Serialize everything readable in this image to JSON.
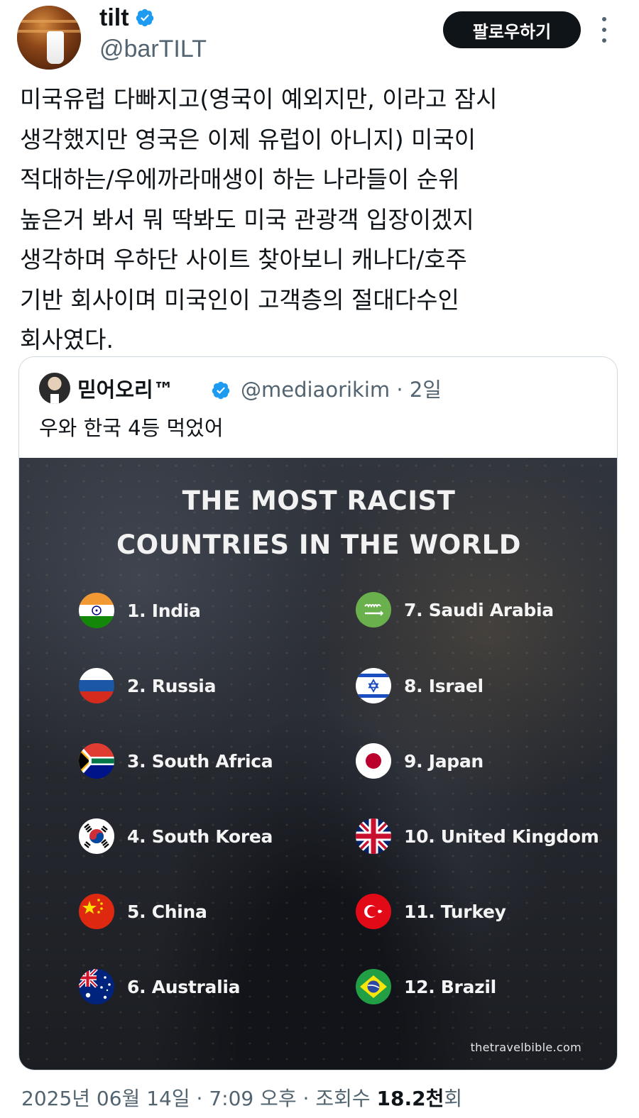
{
  "author": {
    "display_name": "tilt",
    "handle": "@barTILT",
    "verified": true
  },
  "follow_button_label": "팔로우하기",
  "tweet_text": "미국유럽 다빠지고(영국이 예외지만, 이라고 잠시\n생각했지만 영국은 이제 유럽이 아니지) 미국이\n적대하는/우에까라매생이 하는 나라들이 순위\n높은거 봐서 뭐 딱봐도 미국 관광객 입장이겠지\n생각하며 우하단 사이트 찾아보니 캐나다/호주\n기반 회사이며 미국인이 고객층의 절대다수인\n회사였다.",
  "quote": {
    "display_name": "믿어오리™",
    "handle": "@mediaorikim",
    "time_separator": "·",
    "time": "2일",
    "text": "우와 한국 4등 먹었어",
    "image": {
      "title_line1": "THE MOST RACIST",
      "title_line2": "COUNTRIES IN THE WORLD",
      "rankings": [
        {
          "label": "1. India",
          "flag": "india-flag-icon"
        },
        {
          "label": "2. Russia",
          "flag": "russia-flag-icon"
        },
        {
          "label": "3. South Africa",
          "flag": "south-africa-flag-icon"
        },
        {
          "label": "4. South Korea",
          "flag": "south-korea-flag-icon"
        },
        {
          "label": "5. China",
          "flag": "china-flag-icon"
        },
        {
          "label": "6. Australia",
          "flag": "australia-flag-icon"
        },
        {
          "label": "7. Saudi Arabia",
          "flag": "saudi-arabia-flag-icon"
        },
        {
          "label": "8. Israel",
          "flag": "israel-flag-icon"
        },
        {
          "label": "9. Japan",
          "flag": "japan-flag-icon"
        },
        {
          "label": "10. United Kingdom",
          "flag": "united-kingdom-flag-icon"
        },
        {
          "label": "11. Turkey",
          "flag": "turkey-flag-icon"
        },
        {
          "label": "12. Brazil",
          "flag": "brazil-flag-icon"
        }
      ],
      "source": "thetravelbible.com"
    }
  },
  "meta": {
    "date": "2025년 06월 14일",
    "sep1": "·",
    "time": "7:09 오후",
    "sep2": "·",
    "views_label": "조회수",
    "views_count": "18.2천",
    "views_suffix": "회"
  },
  "colors": {
    "verified_blue": "#1d9bf0",
    "text_primary": "#0f1419",
    "text_secondary": "#536471",
    "follow_button_bg": "#0f1419"
  }
}
